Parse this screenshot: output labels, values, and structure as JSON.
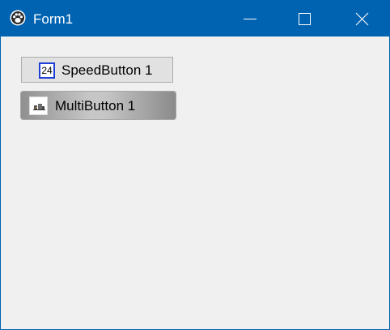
{
  "window": {
    "title": "Form1",
    "icon": "paw-icon",
    "controls": [
      "minimize-icon",
      "maximize-icon",
      "close-icon"
    ],
    "accent_color": "#0063b1"
  },
  "client": {
    "speed_button": {
      "label": "SpeedButton 1",
      "glyph_text": "24",
      "glyph_border_color": "#1f3fd6"
    },
    "multi_button": {
      "label": "MultiButton 1",
      "icon": "image-thumbnail-icon"
    }
  }
}
